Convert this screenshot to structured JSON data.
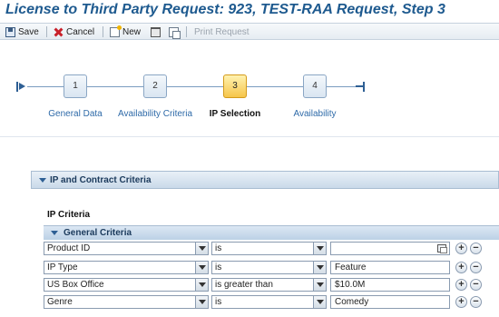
{
  "title": "License to Third Party Request: 923, TEST-RAA Request, Step 3",
  "toolbar": {
    "save": "Save",
    "cancel": "Cancel",
    "new": "New",
    "print": "Print Request"
  },
  "roadmap": {
    "steps": [
      {
        "number": "1",
        "label": "General Data",
        "active": false
      },
      {
        "number": "2",
        "label": "Availability Criteria",
        "active": false
      },
      {
        "number": "3",
        "label": "IP Selection",
        "active": true
      },
      {
        "number": "4",
        "label": "Availability",
        "active": false
      }
    ]
  },
  "section": {
    "title": "IP and Contract Criteria"
  },
  "ip_criteria_label": "IP Criteria",
  "general_criteria": {
    "title": "General Criteria",
    "rows": [
      {
        "field": "Product ID",
        "operator": "is",
        "value": ""
      },
      {
        "field": "IP Type",
        "operator": "is",
        "value": "Feature"
      },
      {
        "field": "US Box Office",
        "operator": "is greater than",
        "value": "$10.0M"
      },
      {
        "field": "Genre",
        "operator": "is",
        "value": "Comedy"
      }
    ]
  },
  "buttons": {
    "add": "+",
    "remove": "−"
  },
  "colors": {
    "title": "#1e5a8f",
    "active_step": "#f6c54a",
    "link": "#2e6aa8",
    "header_bg": "#c9d9e9"
  }
}
